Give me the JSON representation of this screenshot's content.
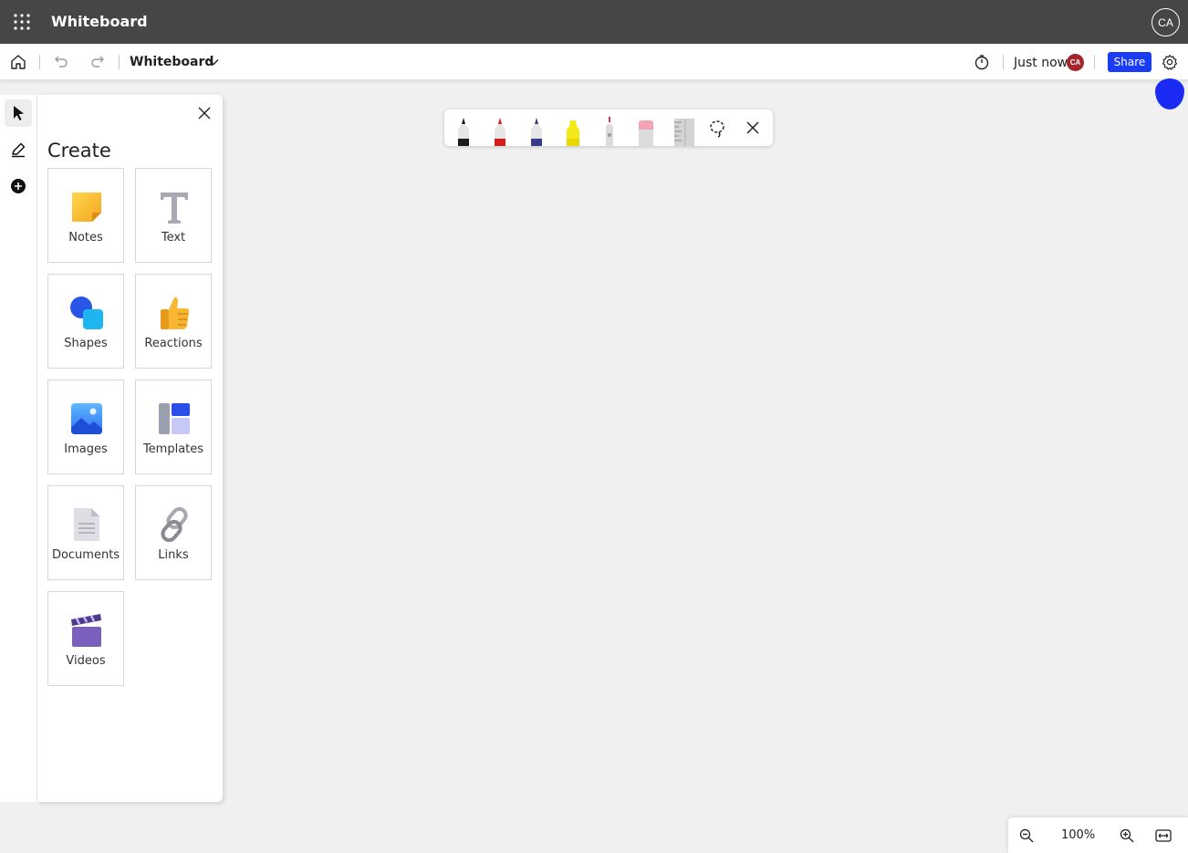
{
  "app": {
    "title": "Whiteboard",
    "avatar_initials": "CA"
  },
  "toolbar": {
    "board_name": "Whiteboard",
    "save_status": "Just now",
    "collaborator_initials": "CA",
    "share_label": "Share",
    "icons": [
      "home-icon",
      "undo-icon",
      "redo-icon",
      "chevron-down-icon",
      "timer-icon",
      "gear-icon"
    ]
  },
  "rail": {
    "items": [
      "select-tool-icon",
      "pen-tool-icon",
      "add-icon"
    ]
  },
  "create_panel": {
    "title": "Create",
    "tiles": [
      {
        "label": "Notes",
        "icon": "sticky-note-icon"
      },
      {
        "label": "Text",
        "icon": "text-icon"
      },
      {
        "label": "Shapes",
        "icon": "shapes-icon"
      },
      {
        "label": "Reactions",
        "icon": "thumbs-up-icon"
      },
      {
        "label": "Images",
        "icon": "image-icon"
      },
      {
        "label": "Templates",
        "icon": "templates-icon"
      },
      {
        "label": "Documents",
        "icon": "document-icon"
      },
      {
        "label": "Links",
        "icon": "link-icon"
      },
      {
        "label": "Videos",
        "icon": "video-icon"
      }
    ]
  },
  "ink_toolbar": {
    "tools": [
      {
        "name": "black-pen",
        "color": "#1b1b1b"
      },
      {
        "name": "red-pen",
        "color": "#d01c1c"
      },
      {
        "name": "blue-pen",
        "color": "#3a3a8c"
      },
      {
        "name": "highlighter",
        "color": "#f2e81a"
      },
      {
        "name": "laser-pointer",
        "color": "#e23a3a"
      },
      {
        "name": "eraser",
        "color": "#f0a4b4"
      },
      {
        "name": "ruler",
        "color": "#c8c8c8"
      }
    ]
  },
  "zoom": {
    "level": "100%"
  },
  "colors": {
    "appbar": "#474646",
    "accent": "#1a3cf4"
  }
}
